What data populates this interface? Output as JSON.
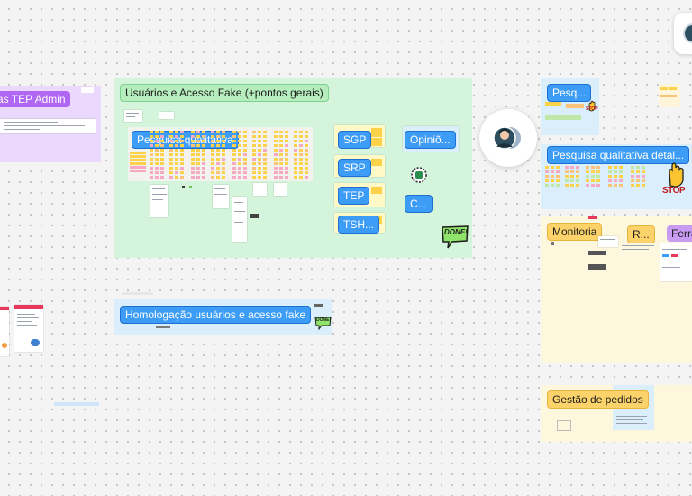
{
  "sections": {
    "tep_admin": {
      "label": "as TEP Admin"
    },
    "usuarios": {
      "label": "Usuários e Acesso Fake (+pontos gerais)"
    },
    "pesquisa": {
      "label": "Pesquisa qualitativa"
    },
    "sgp": {
      "label": "SGP"
    },
    "srp": {
      "label": "SRP"
    },
    "tep": {
      "label": "TEP"
    },
    "tsh": {
      "label": "TSH..."
    },
    "opinio": {
      "label": "Opiniõ..."
    },
    "c": {
      "label": "C..."
    },
    "homologacao": {
      "label": "Homologação usuários e acesso fake"
    },
    "pesq_short": {
      "label": "Pesq..."
    },
    "pesquisa_detal": {
      "label": "Pesquisa qualitativa detal..."
    },
    "monitoria": {
      "label": "Monitoria"
    },
    "r": {
      "label": "R..."
    },
    "ferra": {
      "label": "Ferra"
    },
    "gestao": {
      "label": "Gestão de pedidos"
    }
  },
  "stickers": {
    "done_large": "DONE!",
    "done_small": "DONE!",
    "stop_main": "STOP",
    "stop_small": "STOP"
  },
  "icons": {
    "collaborator_avatar": "avatar-icon",
    "stop_hand": "stop-hand-icon",
    "done_speech": "done-sticker-icon"
  },
  "colors": {
    "section_green": "#d5f4dc",
    "section_blue": "#dbeefc",
    "section_purple": "#ebd8fd",
    "section_cream": "#fdf7dd",
    "label_blue": "#3d9cf5",
    "done_green": "#8fe36b"
  }
}
